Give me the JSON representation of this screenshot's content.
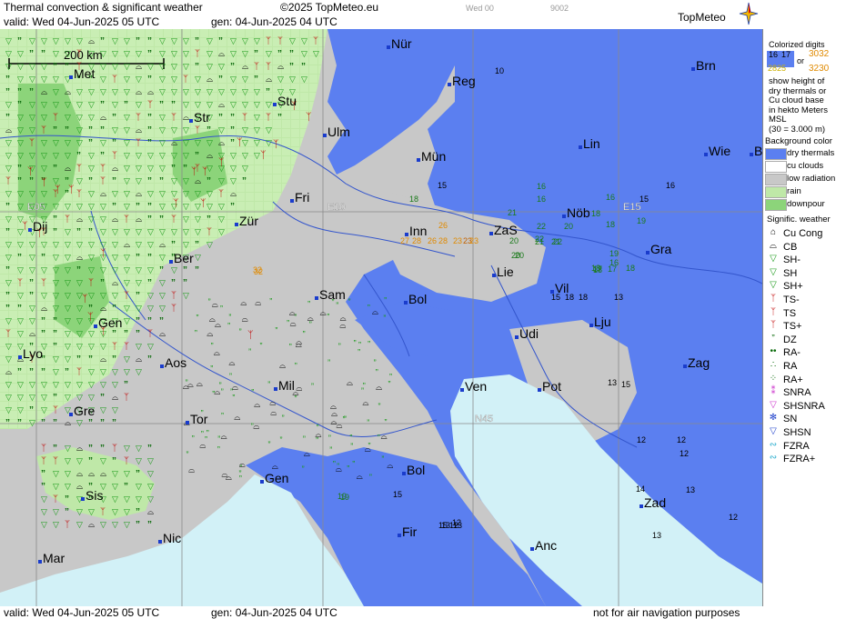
{
  "header": {
    "title": "Thermal convection & significant weather",
    "copyright": "©2025 TopMeteo.eu",
    "small1": "Wed 00",
    "small2": "9002",
    "valid": "valid:  Wed  04-Jun-2025  05 UTC",
    "gen": "gen: 04-Jun-2025 04 UTC",
    "logo": "TopMeteo"
  },
  "footer": {
    "valid": "valid:  Wed  04-Jun-2025  05 UTC",
    "gen": "gen: 04-Jun-2025 04 UTC",
    "note": "not for air navigation purposes"
  },
  "scale_label": "200 km",
  "grid_labels": [
    "E05",
    "E10",
    "E15",
    "N45"
  ],
  "cities": [
    "Nür",
    "Reg",
    "Brn",
    "Met",
    "Stu",
    "Str",
    "Ulm",
    "Mün",
    "Lin",
    "Wie",
    "B",
    "Fri",
    "Inn",
    "ZaS",
    "Nöb",
    "Gra",
    "Dij",
    "Zür",
    "Ber",
    "Lie",
    "Vil",
    "Bol",
    "Sam",
    "Lju",
    "Gen",
    "Lyo",
    "Udi",
    "Aos",
    "Mil",
    "Zag",
    "Ven",
    "Pot",
    "Gre",
    "Tor",
    "Gen",
    "Bol",
    "Zad",
    "Sis",
    "Fir",
    "Nic",
    "Anc",
    "Mar"
  ],
  "digits": [
    "10",
    "15",
    "16",
    "16",
    "15",
    "16",
    "18",
    "16",
    "18",
    "18",
    "19",
    "21",
    "20",
    "22",
    "20",
    "22",
    "21",
    "21",
    "22",
    "26",
    "28",
    "26",
    "23",
    "27",
    "28",
    "32",
    "23",
    "23",
    "20",
    "19",
    "18",
    "18",
    "17",
    "17",
    "18",
    "16",
    "18",
    "18",
    "15",
    "13",
    "15",
    "19",
    "15",
    "13",
    "12",
    "13",
    "12",
    "12",
    "12",
    "15",
    "13",
    "14",
    "13",
    "12",
    "12",
    "13",
    "19",
    "32",
    "20"
  ],
  "legend": {
    "digits_title": "Colorized digits",
    "d1": "16",
    "d2": "17",
    "or": "or",
    "d3": "3032",
    "d4": "2825",
    "d5": "3230",
    "desc": [
      "show height of",
      "dry thermals or",
      "Cu cloud base",
      "in hekto Meters",
      "MSL",
      "(30 = 3.000 m)"
    ],
    "bg_title": "Background color",
    "bg": [
      {
        "label": "dry thermals",
        "color": "#5b7ff0"
      },
      {
        "label": "cu clouds",
        "color": "#ffffff"
      },
      {
        "label": "low radiation",
        "color": "#c8c8c8"
      },
      {
        "label": "rain",
        "color": "#bfe8a8"
      },
      {
        "label": "downpour",
        "color": "#8cd47a"
      }
    ],
    "sig_title": "Signific. weather",
    "sig": [
      {
        "label": "Cu Cong",
        "icon": "cu-cong-icon",
        "color": "#000000"
      },
      {
        "label": "CB",
        "icon": "cb-icon",
        "color": "#000000"
      },
      {
        "label": "SH-",
        "icon": "shower-light-icon",
        "color": "#1a9a1a"
      },
      {
        "label": "SH",
        "icon": "shower-icon",
        "color": "#1a9a1a"
      },
      {
        "label": "SH+",
        "icon": "shower-heavy-icon",
        "color": "#1a9a1a"
      },
      {
        "label": "TS-",
        "icon": "thunderstorm-light-icon",
        "color": "#c00000"
      },
      {
        "label": "TS",
        "icon": "thunderstorm-icon",
        "color": "#c00000"
      },
      {
        "label": "TS+",
        "icon": "thunderstorm-heavy-icon",
        "color": "#c00000"
      },
      {
        "label": "DZ",
        "icon": "drizzle-icon",
        "color": "#0a6a0a"
      },
      {
        "label": "RA-",
        "icon": "rain-light-icon",
        "color": "#0a6a0a"
      },
      {
        "label": "RA",
        "icon": "rain-icon",
        "color": "#0a6a0a"
      },
      {
        "label": "RA+",
        "icon": "rain-heavy-icon",
        "color": "#0a6a0a"
      },
      {
        "label": "SNRA",
        "icon": "snow-rain-icon",
        "color": "#cc33cc"
      },
      {
        "label": "SHSNRA",
        "icon": "snow-rain-shower-icon",
        "color": "#cc33cc"
      },
      {
        "label": "SN",
        "icon": "snow-icon",
        "color": "#2244cc"
      },
      {
        "label": "SHSN",
        "icon": "snow-shower-icon",
        "color": "#2244cc"
      },
      {
        "label": "FZRA",
        "icon": "freezing-rain-icon",
        "color": "#22aacc"
      },
      {
        "label": "FZRA+",
        "icon": "freezing-rain-heavy-icon",
        "color": "#22aacc"
      }
    ]
  },
  "colors": {
    "sea": "#d2f1f7",
    "land_low": "#c8c8c8",
    "dry": "#5b7ff0",
    "rain": "#bfe8a8",
    "downpour": "#8cd47a",
    "city": "#1a3ccc"
  }
}
